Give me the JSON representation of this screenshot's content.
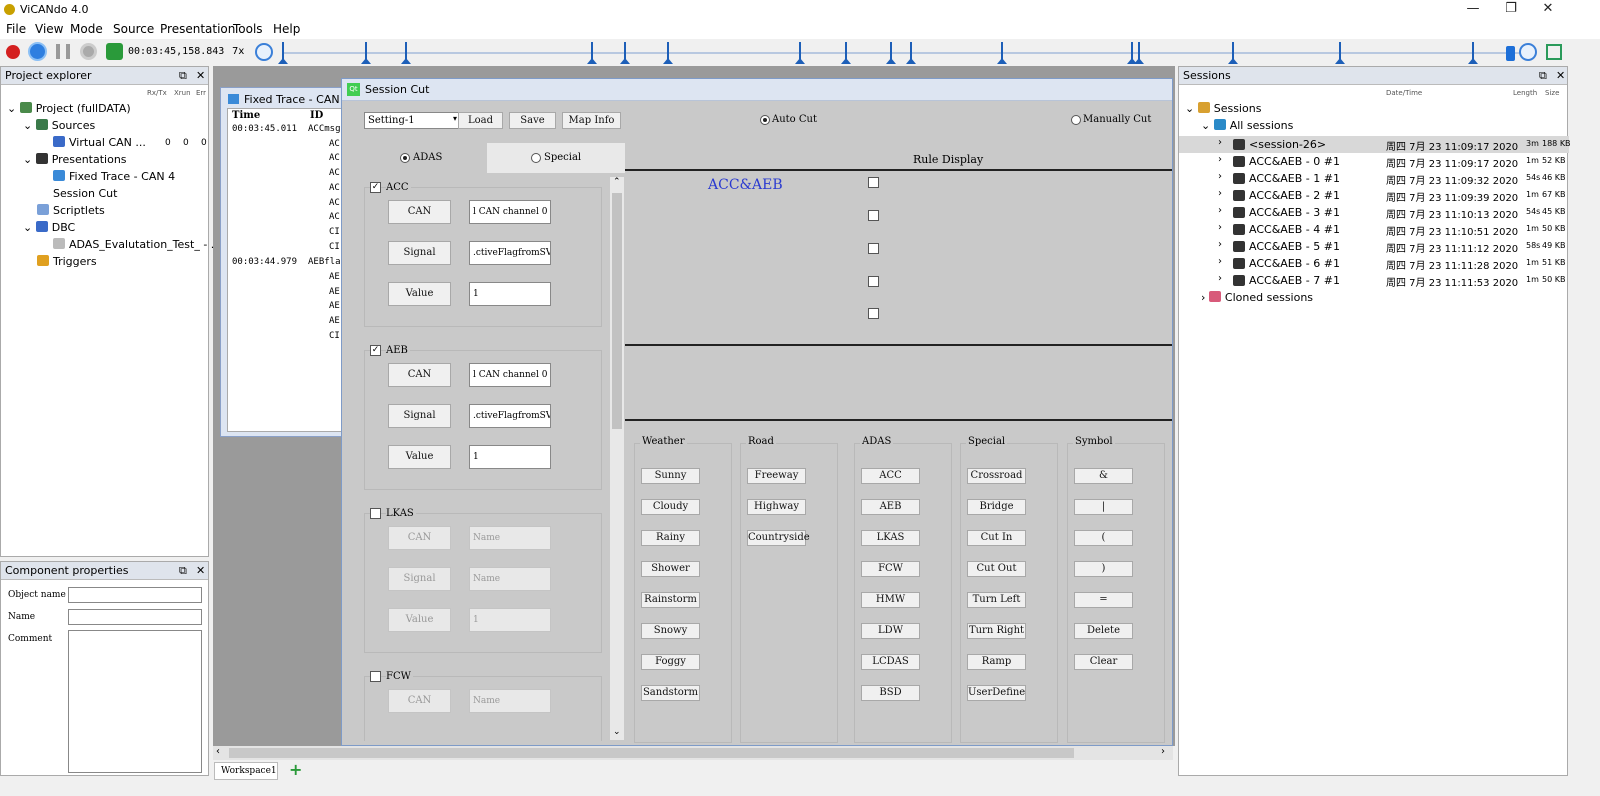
{
  "app": {
    "title": "ViCANdo 4.0"
  },
  "window_controls": {
    "minimize": "—",
    "restore": "❐",
    "close": "✕"
  },
  "menu": [
    "File",
    "View",
    "Mode",
    "Source",
    "Presentation",
    "Tools",
    "Help"
  ],
  "toolbar": {
    "time": "00:03:45,158.843",
    "speed": "7x"
  },
  "project_explorer": {
    "title": "Project explorer",
    "cols": [
      "Rx/Tx",
      "Xrun",
      "Err"
    ],
    "tree": {
      "project": "Project (fullDATA)",
      "sources": "Sources",
      "virtual_can": "Virtual CAN ...",
      "vc_vals": [
        "0",
        "0",
        "0"
      ],
      "presentations": "Presentations",
      "fixed_trace": "Fixed Trace - CAN 4",
      "session_cut": "Session Cut",
      "scriptlets": "Scriptlets",
      "dbc": "DBC",
      "dbc_file": "ADAS_Evalutation_Test_ - ...",
      "triggers": "Triggers"
    }
  },
  "component_properties": {
    "title": "Component properties",
    "object_name": "Object name",
    "name": "Name",
    "comment": "Comment"
  },
  "fixed_trace": {
    "title": "Fixed Trace - CAN 4",
    "cols": [
      "Time",
      "ID"
    ],
    "rows": [
      {
        "time": "00:03:45.011",
        "id": "ACCmsg"
      },
      {
        "time": "",
        "id": "AC"
      },
      {
        "time": "",
        "id": "AC"
      },
      {
        "time": "",
        "id": "AC"
      },
      {
        "time": "",
        "id": "AC"
      },
      {
        "time": "",
        "id": "AC"
      },
      {
        "time": "",
        "id": "AC"
      },
      {
        "time": "",
        "id": "CI"
      },
      {
        "time": "",
        "id": "CI"
      },
      {
        "time": "00:03:44.979",
        "id": "AEBfla"
      },
      {
        "time": "",
        "id": "AE"
      },
      {
        "time": "",
        "id": "AE"
      },
      {
        "time": "",
        "id": "AE"
      },
      {
        "time": "",
        "id": "AE"
      },
      {
        "time": "",
        "id": "CI"
      }
    ]
  },
  "session_cut": {
    "title": "Session Cut",
    "qt": "Qt",
    "setting": "Setting-1",
    "load": "Load",
    "save": "Save",
    "map_info": "Map Info",
    "auto_cut": "Auto Cut",
    "manual_cut": "Manually Cut",
    "tab_adas": "ADAS",
    "tab_special": "Special",
    "rule_display": "Rule Display",
    "rule_text": "ACC&AEB",
    "sections": [
      {
        "name": "ACC",
        "checked": true,
        "can_label": "CAN",
        "can": "l CAN channel 0",
        "signal_label": "Signal",
        "signal": ".ctiveFlagfromSV",
        "value_label": "Value",
        "value": "1"
      },
      {
        "name": "AEB",
        "checked": true,
        "can_label": "CAN",
        "can": "l CAN channel 0",
        "signal_label": "Signal",
        "signal": ".ctiveFlagfromSV",
        "value_label": "Value",
        "value": "1"
      },
      {
        "name": "LKAS",
        "checked": false,
        "can_label": "CAN",
        "can": "Name",
        "signal_label": "Signal",
        "signal": "Name",
        "value_label": "Value",
        "value": "1"
      },
      {
        "name": "FCW",
        "checked": false,
        "can_label": "CAN",
        "can": "Name"
      }
    ],
    "groups": [
      {
        "title": "Weather",
        "buttons": [
          "Sunny",
          "Cloudy",
          "Rainy",
          "Shower",
          "Rainstorm",
          "Snowy",
          "Foggy",
          "Sandstorm"
        ]
      },
      {
        "title": "Road",
        "buttons": [
          "Freeway",
          "Highway",
          "Countryside"
        ]
      },
      {
        "title": "ADAS",
        "buttons": [
          "ACC",
          "AEB",
          "LKAS",
          "FCW",
          "HMW",
          "LDW",
          "LCDAS",
          "BSD"
        ]
      },
      {
        "title": "Special",
        "buttons": [
          "Crossroad",
          "Bridge",
          "Cut In",
          "Cut Out",
          "Turn Left",
          "Turn Right",
          "Ramp",
          "UserDefine"
        ]
      },
      {
        "title": "Symbol",
        "buttons": [
          "&",
          "|",
          "(",
          ")",
          "=",
          "Delete",
          "Clear"
        ]
      }
    ]
  },
  "sessions": {
    "title": "Sessions",
    "col_date": "Date/Time",
    "col_length": "Length",
    "col_size": "Size",
    "root": "Sessions",
    "all": "All sessions",
    "cloned": "Cloned sessions",
    "items": [
      {
        "name": "<session-26>",
        "date": "周四 7月 23 11:09:17 2020",
        "length": "3m",
        "size": "188 KB"
      },
      {
        "name": "ACC&AEB - 0 #1",
        "date": "周四 7月 23 11:09:17 2020",
        "length": "1m",
        "size": "52 KB"
      },
      {
        "name": "ACC&AEB - 1 #1",
        "date": "周四 7月 23 11:09:32 2020",
        "length": "54s",
        "size": "46 KB"
      },
      {
        "name": "ACC&AEB - 2 #1",
        "date": "周四 7月 23 11:09:39 2020",
        "length": "1m",
        "size": "67 KB"
      },
      {
        "name": "ACC&AEB - 3 #1",
        "date": "周四 7月 23 11:10:13 2020",
        "length": "54s",
        "size": "45 KB"
      },
      {
        "name": "ACC&AEB - 4 #1",
        "date": "周四 7月 23 11:10:51 2020",
        "length": "1m",
        "size": "50 KB"
      },
      {
        "name": "ACC&AEB - 5 #1",
        "date": "周四 7月 23 11:11:12 2020",
        "length": "58s",
        "size": "49 KB"
      },
      {
        "name": "ACC&AEB - 6 #1",
        "date": "周四 7月 23 11:11:28 2020",
        "length": "1m",
        "size": "51 KB"
      },
      {
        "name": "ACC&AEB - 7 #1",
        "date": "周四 7月 23 11:11:53 2020",
        "length": "1m",
        "size": "50 KB"
      }
    ]
  },
  "workspace": {
    "tab": "Workspace1",
    "add": "+"
  }
}
